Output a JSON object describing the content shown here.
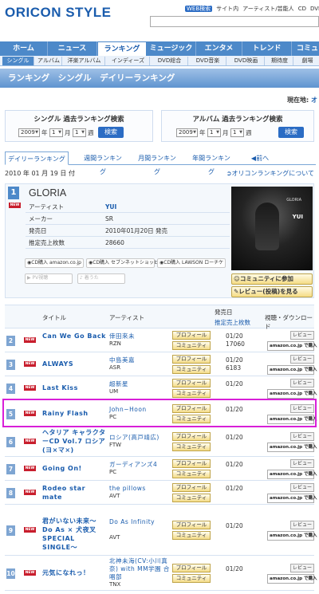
{
  "header": {
    "logo": "ORICON STYLE",
    "web_search": "WEB検索",
    "toplinks": [
      "サイト内",
      "アーティスト/芸能人",
      "CD",
      "DVD"
    ]
  },
  "nav": {
    "tabs": [
      "ホーム",
      "ニュース",
      "ランキング",
      "ミュージック",
      "エンタメ",
      "トレンド",
      "コミュ"
    ],
    "active": "ランキング",
    "subtabs": [
      "シングル",
      "アルバム",
      "洋楽アルバム",
      "インディーズ",
      "DVD総合",
      "DVD音楽",
      "DVD映画",
      "期待度",
      "劇場"
    ]
  },
  "page_title": "ランキング　シングル　デイリーランキング",
  "location": {
    "label": "現在地:",
    "value": "オ"
  },
  "search": {
    "single_title": "シングル 過去ランキング検索",
    "album_title": "アルバム 過去ランキング検索",
    "year": "2009",
    "month": "1",
    "week": "1",
    "year_unit": "年",
    "month_unit": "月",
    "week_unit": "週",
    "button": "検索"
  },
  "ranking_tabs": [
    "デイリーランキング",
    "週間ランキング",
    "月間ランキング",
    "年間ランキング",
    "前へ"
  ],
  "date_label": "2010 年 01 月 19 日 付",
  "about_link": "オリコンランキングについて",
  "featured": {
    "rank": "1",
    "title": "GLORIA",
    "new_badge": "NEW",
    "fields": [
      {
        "label": "アーティスト",
        "value": "YUI"
      },
      {
        "label": "メーカー",
        "value": "SR"
      },
      {
        "label": "発売日",
        "value": "2010年01月20日 発売"
      },
      {
        "label": "推定売上枚数",
        "value": "28660"
      }
    ],
    "jacket_text": [
      "GLORIA",
      "YUI"
    ],
    "cd_buttons": [
      "CD購入 amazon.co.jp",
      "CD購入 セブンネットショッピング",
      "CD購入 LAWSON ローチケ"
    ],
    "pv_button": "PV視聴",
    "ringtone_button": "着うた",
    "community_button": "コミュニティに参加",
    "review_button": "レビュー(投稿)を見る"
  },
  "table": {
    "headers": {
      "title": "タイトル",
      "artist": "アーティスト",
      "release": "発売日",
      "sales": "推定売上枚数",
      "download": "視聴・ダウンロード"
    },
    "profile_label": "プロフィール",
    "community_label": "コミュニティ",
    "review_label": "レビュー",
    "amazon_label": "amazon.co.jp で購入",
    "rows": [
      {
        "rank": "2",
        "title": "Can We Go Back",
        "artist": "倖田來未",
        "maker": "RZN",
        "date": "01/20",
        "sales": "17060"
      },
      {
        "rank": "3",
        "title": "ALWAYS",
        "artist": "中島美嘉",
        "maker": "ASR",
        "date": "01/20",
        "sales": "6183"
      },
      {
        "rank": "4",
        "title": "Last Kiss",
        "artist": "超新星",
        "maker": "UM",
        "date": "01/20",
        "sales": ""
      },
      {
        "rank": "5",
        "title": "Rainy Flash",
        "artist": "John−Hoon",
        "maker": "PC",
        "date": "01/20",
        "sales": ""
      },
      {
        "rank": "6",
        "title": "ヘタリア キャラクターCD Vol.7 ロシア(ヨ×マ×)",
        "artist": "ロシア(高戸靖広)",
        "maker": "FTW",
        "date": "01/20",
        "sales": ""
      },
      {
        "rank": "7",
        "title": "Going On!",
        "artist": "ガーディアンズ4",
        "maker": "PC",
        "date": "01/20",
        "sales": ""
      },
      {
        "rank": "8",
        "title": "Rodeo star mate",
        "artist": "the pillows",
        "maker": "AVT",
        "date": "01/20",
        "sales": ""
      },
      {
        "rank": "9",
        "title": "君がいない未来〜Do As × 犬夜叉 SPECIAL SINGLE〜",
        "artist": "Do As Infinity",
        "maker": "AVT",
        "date": "01/20",
        "sales": ""
      },
      {
        "rank": "10",
        "title": "元気になれっ！",
        "artist": "北神未海(CV:小川真奈) with MM学園 合唱部",
        "maker": "TNX",
        "date": "01/20",
        "sales": ""
      }
    ]
  }
}
